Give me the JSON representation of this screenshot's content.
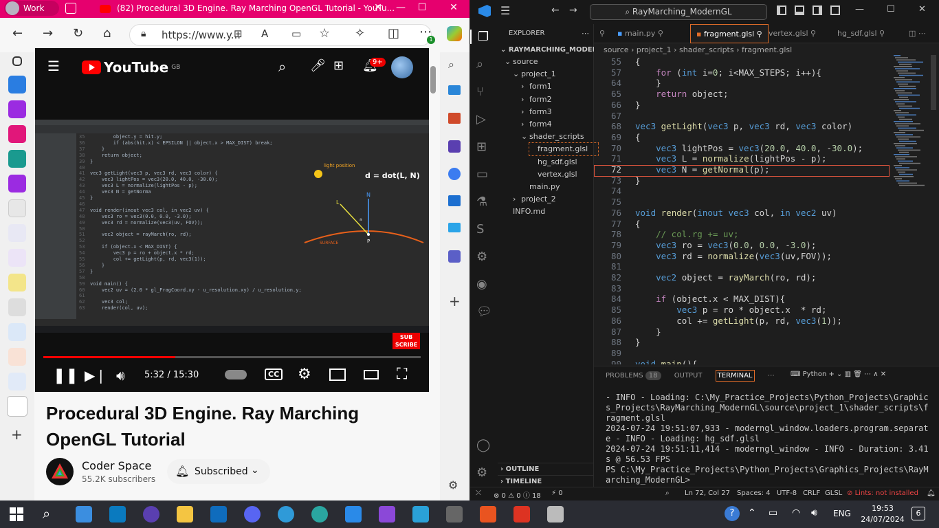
{
  "edge": {
    "profile": "Work",
    "tab_title": "(82) Procedural 3D Engine. Ray Marching OpenGL Tutorial - YouTu...",
    "url": "https://www.y...",
    "sidebar_badge": "1"
  },
  "youtube": {
    "logo": "YouTube",
    "region": "GB",
    "notif_badge": "9+",
    "time": "5:32 / 15:30",
    "progress": 0.35,
    "video_title": "Procedural 3D Engine. Ray Marching OpenGL Tutorial",
    "channel": "Coder Space",
    "subscribers": "55.2K subscribers",
    "subscribed_label": "Subscribed",
    "subscribe_badge": "SUB SCRIBE",
    "video_overlay": {
      "formula": "d = dot(L, N)",
      "light": "light position",
      "surface": "SURFACE",
      "L": "L",
      "N": "N",
      "P": "P",
      "a": "a"
    },
    "video_code": [
      {
        "n": "35",
        "t": "        object.y = hit.y;"
      },
      {
        "n": "36",
        "t": "        if (abs(hit.x) < EPSILON || object.x > MAX_DIST) break;"
      },
      {
        "n": "37",
        "t": "    }"
      },
      {
        "n": "38",
        "t": "    return object;"
      },
      {
        "n": "39",
        "t": "}"
      },
      {
        "n": "40",
        "t": ""
      },
      {
        "n": "41",
        "t": "vec3 getLight(vec3 p, vec3 rd, vec3 color) {"
      },
      {
        "n": "42",
        "t": "    vec3 lightPos = vec3(20.0, 40.0, -30.0);"
      },
      {
        "n": "43",
        "t": "    vec3 L = normalize(lightPos - p);"
      },
      {
        "n": "44",
        "t": "    vec3 N = getNorma"
      },
      {
        "n": "45",
        "t": "}"
      },
      {
        "n": "46",
        "t": ""
      },
      {
        "n": "47",
        "t": "void render(inout vec3 col, in vec2 uv) {"
      },
      {
        "n": "48",
        "t": "    vec3 ro = vec3(0.0, 0.0, -3.0);"
      },
      {
        "n": "49",
        "t": "    vec3 rd = normalize(vec3(uv, FOV));"
      },
      {
        "n": "50",
        "t": ""
      },
      {
        "n": "51",
        "t": "    vec2 object = rayMarch(ro, rd);"
      },
      {
        "n": "52",
        "t": ""
      },
      {
        "n": "53",
        "t": "    if (object.x < MAX_DIST) {"
      },
      {
        "n": "54",
        "t": "        vec3 p = ro + object.x * rd;"
      },
      {
        "n": "55",
        "t": "        col += getLight(p, rd, vec3(1));"
      },
      {
        "n": "56",
        "t": "    }"
      },
      {
        "n": "57",
        "t": "}"
      },
      {
        "n": "58",
        "t": ""
      },
      {
        "n": "59",
        "t": "void main() {"
      },
      {
        "n": "60",
        "t": "    vec2 uv = (2.0 * gl_FragCoord.xy - u_resolution.xy) / u_resolution.y;"
      },
      {
        "n": "61",
        "t": ""
      },
      {
        "n": "62",
        "t": "    vec3 col;"
      },
      {
        "n": "63",
        "t": "    render(col, uv);"
      }
    ]
  },
  "vscode": {
    "search": "RayMarching_ModernGL",
    "explorer_label": "EXPLORER",
    "root": "RAYMARCHING_MODERNGL",
    "tree": [
      {
        "label": "source",
        "arrow": "⌄",
        "depth": 0
      },
      {
        "label": "project_1",
        "arrow": "⌄",
        "depth": 1
      },
      {
        "label": "form1",
        "arrow": "›",
        "depth": 2
      },
      {
        "label": "form2",
        "arrow": "›",
        "depth": 2
      },
      {
        "label": "form3",
        "arrow": "›",
        "depth": 2
      },
      {
        "label": "form4",
        "arrow": "›",
        "depth": 2
      },
      {
        "label": "shader_scripts",
        "arrow": "⌄",
        "depth": 2
      },
      {
        "label": "fragment.glsl",
        "arrow": "",
        "depth": 3
      },
      {
        "label": "hg_sdf.glsl",
        "arrow": "",
        "depth": 3
      },
      {
        "label": "vertex.glsl",
        "arrow": "",
        "depth": 3
      },
      {
        "label": "main.py",
        "arrow": "",
        "depth": 2
      },
      {
        "label": "project_2",
        "arrow": "›",
        "depth": 1
      },
      {
        "label": "INFO.md",
        "arrow": "",
        "depth": 0
      }
    ],
    "tabs": [
      "main.py",
      "fragment.glsl",
      "vertex.glsl",
      "hg_sdf.glsl"
    ],
    "breadcrumb": "source › project_1 › shader_scripts › fragment.glsl",
    "code": [
      {
        "n": "55",
        "t": "{"
      },
      {
        "n": "57",
        "t": "    for (int i=0; i<MAX_STEPS; i++){"
      },
      {
        "n": "64",
        "t": "    }"
      },
      {
        "n": "65",
        "t": "    return object;"
      },
      {
        "n": "66",
        "t": "}"
      },
      {
        "n": "67",
        "t": ""
      },
      {
        "n": "68",
        "t": "vec3 getLight(vec3 p, vec3 rd, vec3 color)"
      },
      {
        "n": "69",
        "t": "{"
      },
      {
        "n": "70",
        "t": "    vec3 lightPos = vec3(20.0, 40.0, -30.0);"
      },
      {
        "n": "71",
        "t": "    vec3 L = normalize(lightPos - p);"
      },
      {
        "n": "72",
        "t": "    vec3 N = getNormal(p);"
      },
      {
        "n": "73",
        "t": "}"
      },
      {
        "n": "74",
        "t": ""
      },
      {
        "n": "75",
        "t": ""
      },
      {
        "n": "76",
        "t": "void render(inout vec3 col, in vec2 uv)"
      },
      {
        "n": "77",
        "t": "{"
      },
      {
        "n": "78",
        "t": "    // col.rg += uv;"
      },
      {
        "n": "79",
        "t": "    vec3 ro = vec3(0.0, 0.0, -3.0);"
      },
      {
        "n": "80",
        "t": "    vec3 rd = normalize(vec3(uv,FOV));"
      },
      {
        "n": "81",
        "t": ""
      },
      {
        "n": "82",
        "t": "    vec2 object = rayMarch(ro, rd);"
      },
      {
        "n": "83",
        "t": ""
      },
      {
        "n": "84",
        "t": "    if (object.x < MAX_DIST){"
      },
      {
        "n": "85",
        "t": "        vec3 p = ro * object.x  * rd;"
      },
      {
        "n": "86",
        "t": "        col += getLight(p, rd, vec3(1));"
      },
      {
        "n": "87",
        "t": "    }"
      },
      {
        "n": "88",
        "t": "}"
      },
      {
        "n": "89",
        "t": ""
      },
      {
        "n": "90",
        "t": "void main(){"
      }
    ],
    "panel": {
      "problems": "PROBLEMS",
      "problems_count": "18",
      "output": "OUTPUT",
      "terminal": "TERMINAL",
      "shell": "Python",
      "lines": [
        " - INFO - Loading: C:\\My_Practice_Projects\\Python_Projects\\Graphics_Projects\\RayMarching_ModernGL\\source\\project_1\\shader_scripts\\fragment.glsl",
        "2024-07-24 19:51:07,933 - moderngl_window.loaders.program.separate - INFO - Loading: hg_sdf.glsl",
        "2024-07-24 19:51:11,414 - moderngl_window - INFO - Duration: 3.41s @ 56.53 FPS",
        "PS C:\\My_Practice_Projects\\Python_Projects\\Graphics_Projects\\RayMarching_ModernGL> "
      ]
    },
    "outline": "OUTLINE",
    "timeline": "TIMELINE",
    "status": {
      "errors": "⊗ 0 ⚠ 0 ⓘ 18",
      "ports": "⚡ 0",
      "position": "Ln 72, Col 27",
      "spaces": "Spaces: 4",
      "encoding": "UTF-8",
      "eol": "CRLF",
      "lang": "GLSL",
      "warning": "Lints: not installed"
    }
  },
  "taskbar": {
    "time": "19:53",
    "date": "24/07/2024",
    "lang": "ENG",
    "notif": "6"
  }
}
